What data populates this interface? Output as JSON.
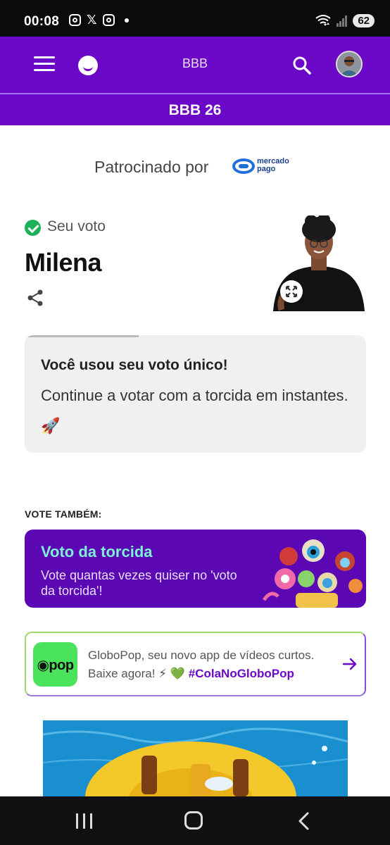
{
  "status_bar": {
    "time": "00:08",
    "x_label": "𝕏",
    "battery": "62",
    "icons": [
      "instagram-icon",
      "x-icon",
      "instagram-icon",
      "dot-icon",
      "wifi-icon",
      "signal-icon",
      "battery-icon"
    ]
  },
  "header": {
    "title": "BBB",
    "section_title": "BBB 26",
    "icons": [
      "menu-icon",
      "globo-smile-icon",
      "search-icon",
      "avatar"
    ]
  },
  "sponsor": {
    "label": "Patrocinado por",
    "brand_line1": "mercado",
    "brand_line2": "pago"
  },
  "vote": {
    "status": "Seu voto",
    "candidate": "Milena"
  },
  "info_card": {
    "title": "Você usou seu voto único!",
    "body": "Continue a votar com a torcida em instantes. 🚀"
  },
  "vote_also": {
    "label": "VOTE TAMBÉM:",
    "card_title": "Voto da torcida",
    "card_desc": "Vote quantas vezes quiser no 'voto da torcida'!"
  },
  "globopop": {
    "logo_text": "pop",
    "line1": "GloboPop, seu novo app de vídeos curtos.",
    "line2_prefix": "Baixe agora! ⚡ 💚",
    "hashtag": "#ColaNoGloboPop"
  },
  "colors": {
    "brand_purple": "#6b08c7",
    "torcida_title": "#7ef0d8",
    "check_green": "#1fb05a",
    "globopop_green": "#4be35c"
  }
}
